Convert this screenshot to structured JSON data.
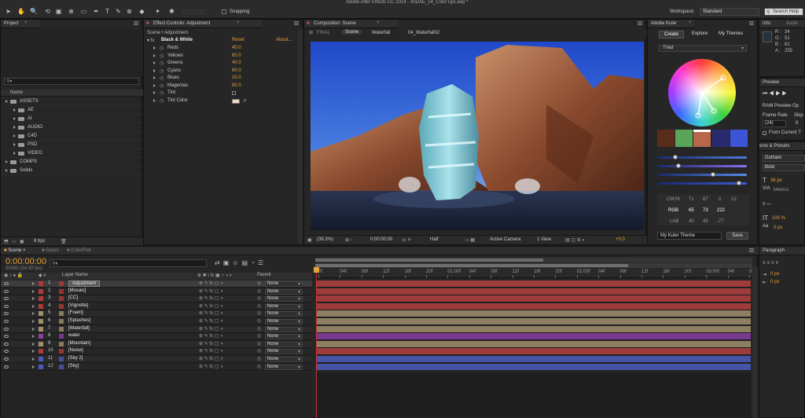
{
  "app": {
    "title": "Adobe After Effects CC 2014 - 30DAE_14_ColorTips.aep *"
  },
  "toolbar": {
    "snapping_label": "Snapping",
    "workspace_label": "Workspace:",
    "workspace_value": "Standard",
    "search_placeholder": "Search Help"
  },
  "project": {
    "tab": "Project",
    "search_placeholder": "",
    "name_header": "Name",
    "items": [
      {
        "label": "ASSETS",
        "indent": 0,
        "open": true
      },
      {
        "label": "AE",
        "indent": 1
      },
      {
        "label": "AI",
        "indent": 1
      },
      {
        "label": "AUDIO",
        "indent": 1
      },
      {
        "label": "C4D",
        "indent": 1
      },
      {
        "label": "PSD",
        "indent": 1
      },
      {
        "label": "VIDEO",
        "indent": 1
      },
      {
        "label": "COMPS",
        "indent": 0
      },
      {
        "label": "Solids",
        "indent": 0
      }
    ],
    "bpc": "8 bpc"
  },
  "effects": {
    "tab": "Effect Controls: Adjustment",
    "breadcrumb": "Scene • Adjustment",
    "effect_name": "Black & White",
    "reset_label": "Reset",
    "about_label": "About...",
    "params": [
      {
        "name": "Reds",
        "value": "40.0"
      },
      {
        "name": "Yellows",
        "value": "60.0"
      },
      {
        "name": "Greens",
        "value": "40.0"
      },
      {
        "name": "Cyans",
        "value": "60.0"
      },
      {
        "name": "Blues",
        "value": "20.0"
      },
      {
        "name": "Magentas",
        "value": "80.0"
      },
      {
        "name": "Tint:",
        "value": ""
      },
      {
        "name": "Tint Color",
        "value": ""
      }
    ]
  },
  "composition": {
    "tab": "Composition: Scene",
    "breadcrumbs": [
      "FINAL",
      "Scene",
      "Waterfall",
      "04_Waterfall02"
    ],
    "zoom": "(39.3%)",
    "timecode": "0:00:00:00",
    "resolution": "Half",
    "camera": "Active Camera",
    "view": "1 View",
    "exposure": "+0.0"
  },
  "kuler": {
    "tab": "Adobe Kuler",
    "tabs": [
      "Create",
      "Explore",
      "My Themes"
    ],
    "rule": "Triad",
    "swatches": [
      "#5a2c1a",
      "#5aa55a",
      "#b8684a",
      "#2a2a6e",
      "#3c55d8"
    ],
    "slider_colors": [
      "#4b7de0",
      "#8c6ef0",
      "#5a8ae8",
      "#3a5ad8"
    ],
    "slider_positions": [
      0.18,
      0.22,
      0.62,
      0.92
    ],
    "modes": [
      "CMYK",
      "RGB",
      "LAB"
    ],
    "cmyk_values": [
      "71",
      "67",
      "0",
      "13"
    ],
    "rgb_values": [
      "65",
      "73",
      "222"
    ],
    "lab_values": [
      "40",
      "45",
      "-77"
    ],
    "theme_name": "My Kuler Theme",
    "save_label": "Save"
  },
  "info": {
    "tab": "Info",
    "tab2": "Audio",
    "r_label": "R :",
    "r": "34",
    "g_label": "G :",
    "g": "51",
    "b_label": "B :",
    "b": "61",
    "a_label": "A :",
    "a": "255"
  },
  "preview": {
    "tab": "Preview",
    "ram_label": "RAM Preview Op",
    "frame_rate_label": "Frame Rate",
    "skip_label": "Skip",
    "frame_rate_value": "(24)",
    "skip_value": "0",
    "from_current": "From Current T"
  },
  "character": {
    "tab": "ects & Presets",
    "font": "Gotham",
    "style": "Bold",
    "size": "36 px",
    "metrics": "Metrics",
    "scale": "100 %",
    "baseline": "0 px"
  },
  "paragraph": {
    "tab": "Paragraph",
    "indent1": "0 px",
    "indent2": "0 px"
  },
  "timeline": {
    "tabs": [
      "Scene",
      "Gears",
      "ColorPick"
    ],
    "timecode": "0:00:00:00",
    "fps": "00000 (24.00 fps)",
    "layer_name_header": "Layer Name",
    "parent_header": "Parent",
    "ruler": [
      "0f",
      "04f",
      "08f",
      "12f",
      "16f",
      "20f",
      "01:00f",
      "04f",
      "08f",
      "12f",
      "16f",
      "20f",
      "02:00f",
      "04f",
      "08f",
      "12f",
      "16f",
      "20f",
      "03:00f",
      "04f",
      "08f"
    ],
    "layers": [
      {
        "num": "1",
        "name": "Adjustment",
        "label_color": "#b03a3a",
        "bar": "#9e3c3c",
        "selected": true
      },
      {
        "num": "2",
        "name": "[Mosaic]",
        "label_color": "#b03a3a",
        "bar": "#9e3c3c"
      },
      {
        "num": "3",
        "name": "[CC]",
        "label_color": "#b03a3a",
        "bar": "#9e3c3c"
      },
      {
        "num": "4",
        "name": "[Vignette]",
        "label_color": "#b03a3a",
        "bar": "#9e3c3c"
      },
      {
        "num": "5",
        "name": "[Foam]",
        "label_color": "#a08f6a",
        "bar": "#8e7f62"
      },
      {
        "num": "6",
        "name": "[Splashes]",
        "label_color": "#a08f6a",
        "bar": "#8e7f62"
      },
      {
        "num": "7",
        "name": "[Waterfall]",
        "label_color": "#a08f6a",
        "bar": "#8e7f62"
      },
      {
        "num": "8",
        "name": "water",
        "label_color": "#8a3ea8",
        "bar": "#7a3a92"
      },
      {
        "num": "9",
        "name": "[Mountain]",
        "label_color": "#a08f6a",
        "bar": "#8e7f62"
      },
      {
        "num": "10",
        "name": "[Noise]",
        "label_color": "#b03a3a",
        "bar": "#9e3c3c"
      },
      {
        "num": "11",
        "name": "[Sky 2]",
        "label_color": "#4a5ab8",
        "bar": "#4654a8"
      },
      {
        "num": "12",
        "name": "[Sky]",
        "label_color": "#4a5ab8",
        "bar": "#4654a8"
      }
    ],
    "parent_value": "None"
  }
}
